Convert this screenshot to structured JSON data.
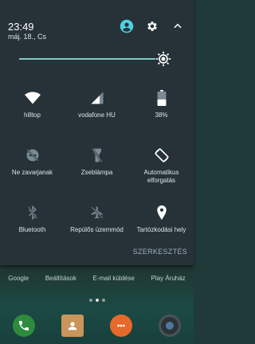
{
  "status": {
    "time": "23:49",
    "date": "máj. 18., Cs"
  },
  "colors": {
    "shade_bg": "#263238",
    "accent": "#80cbc4",
    "user_icon": "#4dd0e1",
    "tile_icon": "#ffffff",
    "tile_icon_disabled": "#7a8a92"
  },
  "header_icons": [
    "account-icon",
    "settings-icon",
    "collapse-icon"
  ],
  "brightness": {
    "level": 0.92
  },
  "tiles": [
    {
      "id": "wifi",
      "label": "hilltop",
      "icon": "wifi-icon",
      "enabled": true
    },
    {
      "id": "cellular",
      "label": "vodafone HU",
      "icon": "signal-icon",
      "enabled": true
    },
    {
      "id": "battery",
      "label": "38%",
      "icon": "battery-icon",
      "enabled": true
    },
    {
      "id": "dnd",
      "label": "Ne zavarjanak",
      "icon": "do-not-disturb-off-icon",
      "enabled": false
    },
    {
      "id": "flashlight",
      "label": "Zseblámpa",
      "icon": "flashlight-off-icon",
      "enabled": false
    },
    {
      "id": "autorotate",
      "label": "Automatikus\nelforgatás",
      "icon": "screen-rotation-icon",
      "enabled": true
    },
    {
      "id": "bluetooth",
      "label": "Bluetooth",
      "icon": "bluetooth-off-icon",
      "enabled": false
    },
    {
      "id": "airplane",
      "label": "Repülős üzemmód",
      "icon": "airplane-mode-off-icon",
      "enabled": false
    },
    {
      "id": "location",
      "label": "Tartózkodási hely",
      "icon": "location-icon",
      "enabled": true
    }
  ],
  "edit_label": "SZERKESZTÉS",
  "home": {
    "shortcuts": [
      "Google",
      "Beállítások",
      "E-mail küldése",
      "Play Áruház"
    ],
    "dock": [
      "phone-app-icon",
      "contacts-app-icon",
      "messages-app-icon",
      "camera-app-icon"
    ]
  }
}
